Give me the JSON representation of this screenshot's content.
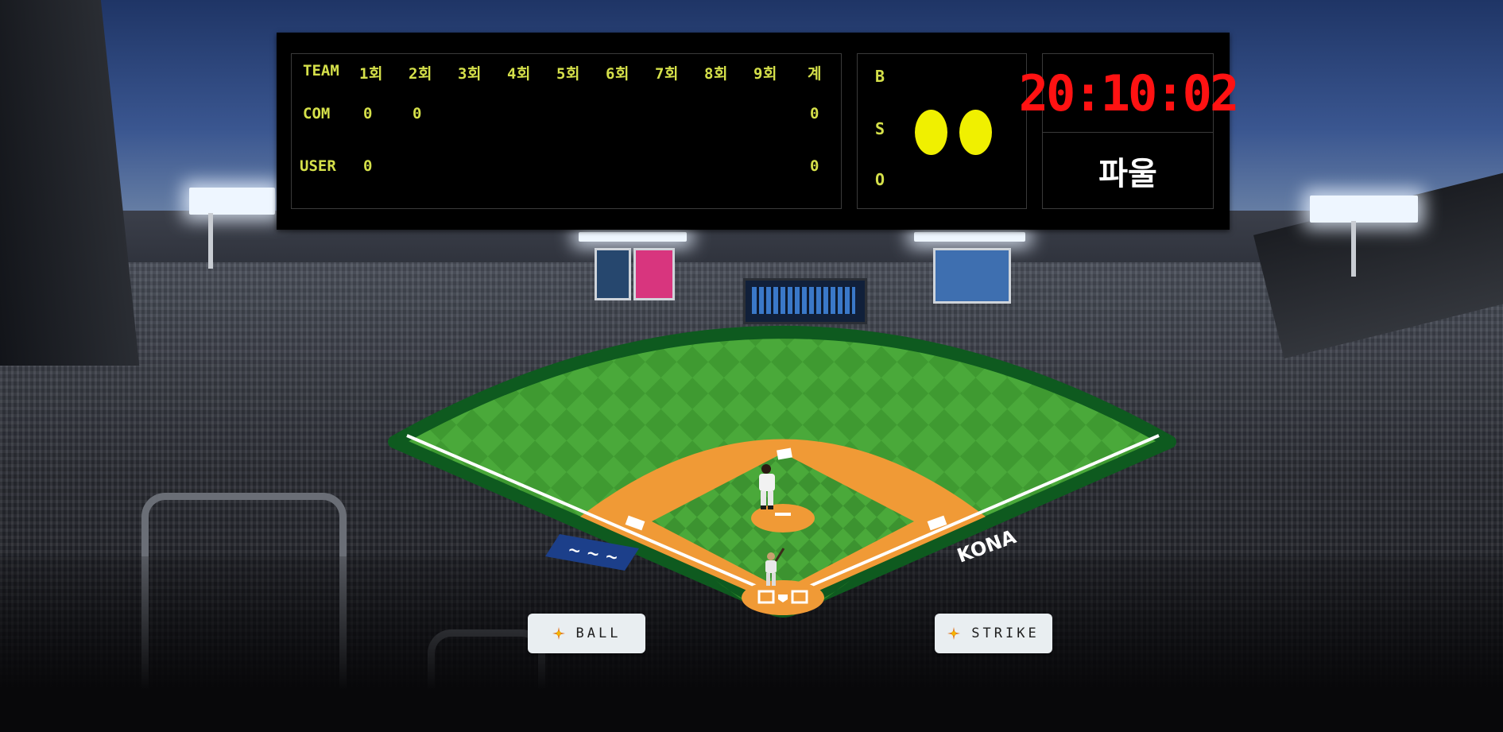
{
  "scoreboard": {
    "header": {
      "team_label": "TEAM",
      "innings": [
        "1회",
        "2회",
        "3회",
        "4회",
        "5회",
        "6회",
        "7회",
        "8회",
        "9회"
      ],
      "total_label": "계"
    },
    "teams": [
      {
        "name": "COM",
        "scores": [
          "0",
          "0",
          "",
          "",
          "",
          "",
          "",
          "",
          ""
        ],
        "total": "0"
      },
      {
        "name": "USER",
        "scores": [
          "0",
          "",
          "",
          "",
          "",
          "",
          "",
          "",
          ""
        ],
        "total": "0"
      }
    ],
    "count": {
      "labels": [
        "B",
        "S",
        "O"
      ],
      "balls": 0,
      "strikes": 2,
      "outs": 0
    },
    "clock": "20:10:02",
    "status": "파울"
  },
  "colors": {
    "score_text": "#d5e04a",
    "clock_text": "#ff1212",
    "count_light": "#f0f000",
    "infield_dirt": "#f09a36",
    "outfield_grass": "#4aa93a",
    "field_border": "#0e5a1f"
  },
  "buttons": {
    "ball": {
      "label": "BALL",
      "icon": "baseball-sparkle-icon"
    },
    "strike": {
      "label": "STRIKE",
      "icon": "baseball-sparkle-icon"
    }
  },
  "field": {
    "signage_left": "",
    "signage_right": "KONA"
  }
}
